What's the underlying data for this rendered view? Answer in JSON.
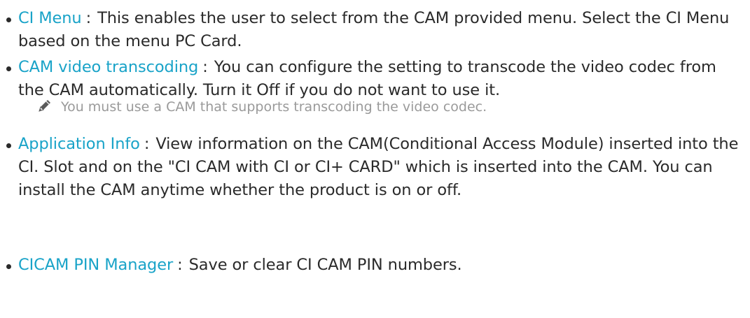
{
  "items": [
    {
      "term": "CI Menu",
      "separator": ":",
      "description": "This enables the user to select from the CAM provided menu. Select the CI Menu based on the menu PC Card."
    },
    {
      "term": "CAM video transcoding",
      "separator": ":",
      "description": "You can configure the setting to transcode the video codec from the CAM automatically. Turn it Off if you do not want to use it."
    },
    {
      "term": "Application Info",
      "separator": ":",
      "description": "View information on the CAM(Conditional Access Module) inserted into the CI. Slot and on the \"CI CAM with CI or CI+ CARD\" which is inserted into the CAM. You can install the CAM anytime whether the product is on or off."
    },
    {
      "term": "CICAM PIN Manager",
      "separator": ":",
      "description": "Save or clear CI CAM PIN numbers."
    }
  ],
  "note": {
    "icon": "pencil-note-icon",
    "text": "You must use a CAM that supports transcoding the video codec."
  },
  "colors": {
    "term": "#19a3c8",
    "body_text": "#2a2a2a",
    "note_text": "#9a9a9a"
  }
}
